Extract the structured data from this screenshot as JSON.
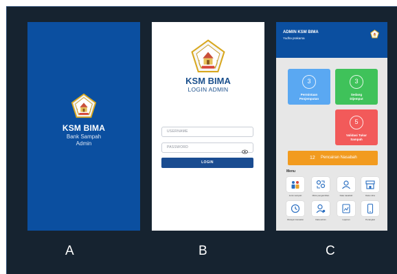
{
  "panels": {
    "a": {
      "letter": "A",
      "brand": "KSM BIMA",
      "subtitle_line1": "Bank Sampah",
      "subtitle_line2": "Admin",
      "background": "#0b4fa0"
    },
    "b": {
      "letter": "B",
      "brand": "KSM BIMA",
      "subtitle": "LOGIN ADMIN",
      "username_placeholder": "USERNAME",
      "password_placeholder": "PASSWORD",
      "login_label": "LOGIN",
      "accent": "#1a4c91"
    },
    "c": {
      "letter": "C",
      "header_title": "ADMIN KSM BIMA",
      "header_name": "Yudha prakarsa",
      "cards": {
        "permintaan": {
          "count": "3",
          "label_line1": "Permintaan",
          "label_line2": "Penjemputan",
          "color": "#5aa8f2"
        },
        "dijemput": {
          "count": "3",
          "label_line1": "Sedang",
          "label_line2": "Dijemput",
          "color": "#3fc25a"
        },
        "tukar": {
          "count": "5",
          "label_line1": "Validasi Tukar",
          "label_line2": "Sampah",
          "color": "#f25a5a"
        }
      },
      "pencairan": {
        "count": "12",
        "label": "Pencairan Nasabah",
        "color": "#f29b1f"
      },
      "menu_title": "Menu",
      "menu": [
        {
          "label": "Jenis sampah",
          "icon": "recycle-people-icon"
        },
        {
          "label": "Mitra pengambilan",
          "icon": "exchange-people-icon"
        },
        {
          "label": "Data nasabah",
          "icon": "user-profile-icon"
        },
        {
          "label": "Data mitra",
          "icon": "store-icon"
        },
        {
          "label": "Riwayat transaksi",
          "icon": "history-icon"
        },
        {
          "label": "Data admin",
          "icon": "admin-user-icon"
        },
        {
          "label": "Laporan",
          "icon": "report-icon"
        },
        {
          "label": "Perangkat",
          "icon": "phone-icon"
        }
      ]
    }
  }
}
